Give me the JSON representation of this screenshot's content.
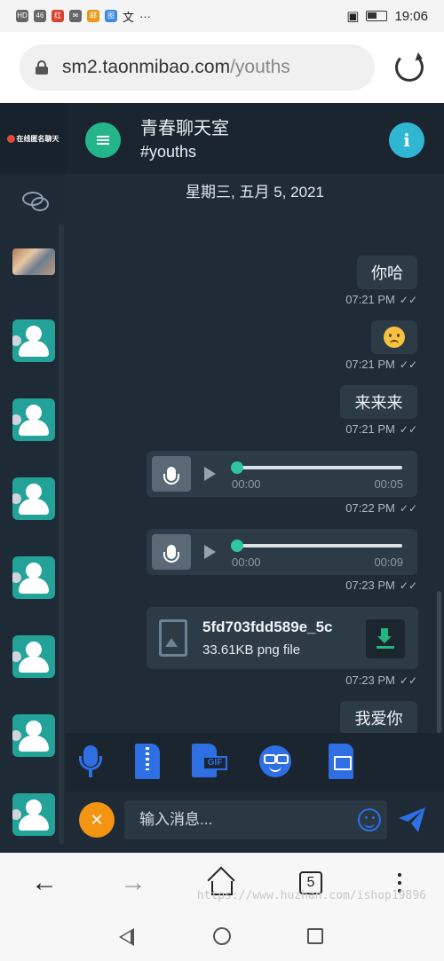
{
  "status_bar": {
    "left_indicators": [
      "HD",
      "46",
      "红",
      "✉",
      "邮",
      "图",
      "文",
      "···"
    ],
    "time": "19:06"
  },
  "browser": {
    "url_host": "sm2.taonmibao.com",
    "url_path": "/youths",
    "tab_count": "5"
  },
  "sidebar": {
    "brand": "在线匿名聊天",
    "avatars_count": 7
  },
  "chat": {
    "room_title": "青春聊天室",
    "room_tag": "#youths",
    "date_separator": "星期三, 五月 5, 2021",
    "messages": [
      {
        "type": "text",
        "text": "你哈",
        "time": "07:21 PM"
      },
      {
        "type": "emoji",
        "emoji": "sad-face",
        "time": "07:21 PM"
      },
      {
        "type": "text",
        "text": "来来来",
        "time": "07:21 PM"
      },
      {
        "type": "voice",
        "start": "00:00",
        "end": "00:05",
        "time": "07:22 PM"
      },
      {
        "type": "voice",
        "start": "00:00",
        "end": "00:09",
        "time": "07:23 PM"
      },
      {
        "type": "file",
        "name": "5fd703fdd589e_5c",
        "meta": "33.61KB png file",
        "time": "07:23 PM"
      },
      {
        "type": "text",
        "text": "我爱你"
      }
    ]
  },
  "composer": {
    "placeholder": "输入消息..."
  },
  "watermark": "https://www.huzhan.com/ishop19896",
  "colors": {
    "menu_button": "#25b58b",
    "info_button": "#2fb6d3",
    "accent_blue": "#2e6fe3",
    "close_button": "#f39412",
    "avatar": "#22a298"
  }
}
